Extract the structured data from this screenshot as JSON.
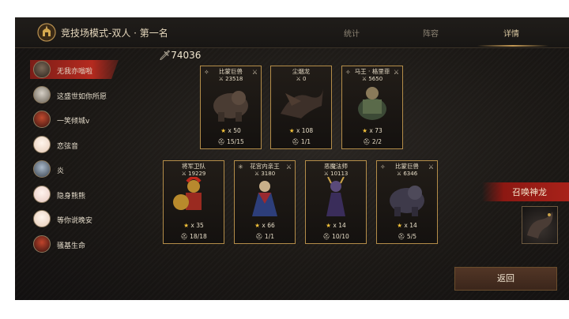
{
  "header": {
    "title": "竞技场模式-双人 · 第一名",
    "tabs": [
      {
        "label": "统计"
      },
      {
        "label": "阵容"
      },
      {
        "label": "详情"
      }
    ]
  },
  "friends": [
    {
      "name": "无我亦嗡啦",
      "active": true
    },
    {
      "name": "这盛世如你所愿"
    },
    {
      "name": "一笑倾城v"
    },
    {
      "name": "恋弦音"
    },
    {
      "name": "炎"
    },
    {
      "name": "隐身熊熊"
    },
    {
      "name": "等你说晚安"
    },
    {
      "name": "骚基生命"
    }
  ],
  "total_power": "74036",
  "cards": [
    {
      "name": "比蒙巨兽",
      "power": "23518",
      "count": "x 50",
      "level": "15/15"
    },
    {
      "name": "尘烟龙",
      "power": "0",
      "count": "x 108",
      "level": "1/1"
    },
    {
      "name": "马王 · 格里菲",
      "power": "5650",
      "count": "x 73",
      "level": "2/2"
    },
    {
      "name": "将军卫队",
      "power": "19229",
      "count": "x 35",
      "level": "18/18"
    },
    {
      "name": "花宫内亲王",
      "power": "3180",
      "count": "x 66",
      "level": "1/1"
    },
    {
      "name": "恶魔法师",
      "power": "10113",
      "count": "x 14",
      "level": "10/10"
    },
    {
      "name": "比蒙巨兽",
      "power": "6346",
      "count": "x 14",
      "level": "5/5"
    }
  ],
  "summon": {
    "label": "召唤神龙"
  },
  "back_button": {
    "label": "返回"
  }
}
